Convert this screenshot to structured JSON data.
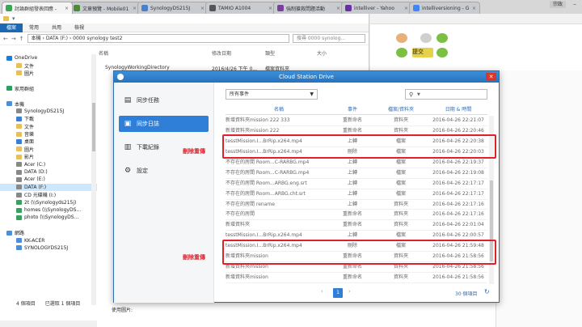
{
  "browser": {
    "tabs": [
      {
        "label": "討論群組發表回應 -",
        "color": "#3aa655",
        "active": true
      },
      {
        "label": "文章預覽 - Mobile01",
        "color": "#4a8a3a",
        "active": false
      },
      {
        "label": "SynologyDS215J",
        "color": "#4a7fcc",
        "active": false
      },
      {
        "label": "TAMIO A1004",
        "color": "#555555",
        "active": false
      },
      {
        "label": "強制搶救問題活動",
        "color": "#7b3fa0",
        "active": false
      },
      {
        "label": "intelliver - Yahoo",
        "color": "#6a2fa0",
        "active": false
      },
      {
        "label": "intelliversioning - G",
        "color": "#4285f4",
        "active": false
      }
    ],
    "user_badge": "宗政"
  },
  "explorer": {
    "ribbon_tabs": [
      "檔案",
      "常用",
      "共用",
      "檢視"
    ],
    "address_parts": [
      "本機",
      "DATA (F:)",
      "0000 synology test2"
    ],
    "search_placeholder": "搜尋 0000 synolog...",
    "columns": [
      "名稱",
      "修改日期",
      "類型",
      "大小"
    ],
    "file": {
      "name": "SynologyWorkingDirectory",
      "date": "2016/4/26 下午 0...",
      "type": "檔案資料夾"
    },
    "nav": [
      {
        "label": "OneDrive",
        "color": "#1e7bd7",
        "indent": 0
      },
      {
        "label": "文件",
        "color": "#e8c05a",
        "indent": 1
      },
      {
        "label": "圖片",
        "color": "#e8c05a",
        "indent": 1
      },
      {
        "label": "",
        "color": "",
        "indent": 0
      },
      {
        "label": "家用群組",
        "color": "#2aa060",
        "indent": 0
      },
      {
        "label": "",
        "color": "",
        "indent": 0
      },
      {
        "label": "本機",
        "color": "#4a8fd8",
        "indent": 0
      },
      {
        "label": "SynologyDS215J",
        "color": "#888888",
        "indent": 1
      },
      {
        "label": "下載",
        "color": "#3a7fd0",
        "indent": 1
      },
      {
        "label": "文件",
        "color": "#e8c05a",
        "indent": 1
      },
      {
        "label": "音樂",
        "color": "#e8c05a",
        "indent": 1
      },
      {
        "label": "桌面",
        "color": "#3a7fd0",
        "indent": 1
      },
      {
        "label": "圖片",
        "color": "#e8c05a",
        "indent": 1
      },
      {
        "label": "影片",
        "color": "#e8c05a",
        "indent": 1
      },
      {
        "label": "Acer (C:)",
        "color": "#888888",
        "indent": 1
      },
      {
        "label": "DATA (D:)",
        "color": "#888888",
        "indent": 1
      },
      {
        "label": "Acer (E:)",
        "color": "#888888",
        "indent": 1
      },
      {
        "label": "DATA (F:)",
        "color": "#888888",
        "indent": 1,
        "selected": true
      },
      {
        "label": "CD 光碟機 (I:)",
        "color": "#888888",
        "indent": 1
      },
      {
        "label": "2t (\\\\Synologyds215j)",
        "color": "#3aa060",
        "indent": 1
      },
      {
        "label": "homes (\\\\SynologyDS...",
        "color": "#3aa060",
        "indent": 1
      },
      {
        "label": "photo (\\\\SynologyDS...",
        "color": "#3aa060",
        "indent": 1
      },
      {
        "label": "",
        "color": "",
        "indent": 0
      },
      {
        "label": "網路",
        "color": "#4a8fd8",
        "indent": 0
      },
      {
        "label": "KK-ACER",
        "color": "#4a8fd8",
        "indent": 1
      },
      {
        "label": "SYNOLOGYDS215J",
        "color": "#4a8fd8",
        "indent": 1
      }
    ],
    "status_items": "4 個項目",
    "status_selected": "已選取 1 個項目"
  },
  "webpage": {
    "bottom_label": "使用圖片:",
    "button_label": "提交"
  },
  "csd": {
    "title": "Cloud Station Drive",
    "nav": [
      {
        "label": "同步任務",
        "icon": "▤",
        "active": false
      },
      {
        "label": "同步日誌",
        "icon": "▣",
        "active": true
      },
      {
        "label": "下載紀錄",
        "icon": "▥",
        "active": false
      },
      {
        "label": "設定",
        "icon": "⚙",
        "active": false
      }
    ],
    "filter": "所有事件",
    "search_icon": "⚲",
    "columns": {
      "name": "名稱",
      "event": "事件",
      "type": "檔案/資料夾",
      "date": "日期 & 時間"
    },
    "rows": [
      {
        "name": "新增資料夾mission 222 333",
        "event": "重新命名",
        "type": "資料夾",
        "date": "2016-04-26 22:21:07"
      },
      {
        "name": "新增資料夾mission 222",
        "event": "重新命名",
        "type": "資料夾",
        "date": "2016-04-26 22:20:46"
      },
      {
        "name": "tesstMission.I...BrRip.x264.mp4",
        "event": "上轉",
        "type": "檔案",
        "date": "2016-04-26 22:20:38"
      },
      {
        "name": "tesstMission.I...BrRip.x264.mp4",
        "event": "刪除",
        "type": "檔案",
        "date": "2016-04-26 22:20:03"
      },
      {
        "name": "不存在的房間 Room...C-RARBG.mp4",
        "event": "上轉",
        "type": "檔案",
        "date": "2016-04-26 22:19:37"
      },
      {
        "name": "不存在的房間 Room...C-RARBG.mp4",
        "event": "上轉",
        "type": "檔案",
        "date": "2016-04-26 22:19:08"
      },
      {
        "name": "不存在的房間 Room...ARBG.eng.srt",
        "event": "上轉",
        "type": "檔案",
        "date": "2016-04-26 22:17:17"
      },
      {
        "name": "不存在的房間 Room...ARBG.cht.srt",
        "event": "上轉",
        "type": "檔案",
        "date": "2016-04-26 22:17:17"
      },
      {
        "name": "不存在的房間 rename",
        "event": "上轉",
        "type": "資料夾",
        "date": "2016-04-26 22:17:16"
      },
      {
        "name": "不存在的房間",
        "event": "重新命名",
        "type": "資料夾",
        "date": "2016-04-26 22:17:16"
      },
      {
        "name": "新增資料夾",
        "event": "重新命名",
        "type": "資料夾",
        "date": "2016-04-26 22:01:04"
      },
      {
        "name": "tesstMission.I...BrRip.x264.mp4",
        "event": "上轉",
        "type": "檔案",
        "date": "2016-04-26 22:00:57"
      },
      {
        "name": "tesstMission.I...BrRip.x264.mp4",
        "event": "刪除",
        "type": "檔案",
        "date": "2016-04-26 21:59:48"
      },
      {
        "name": "新增資料夾mission",
        "event": "重新命名",
        "type": "資料夾",
        "date": "2016-04-26 21:58:56"
      },
      {
        "name": "新增資料夾mission",
        "event": "重新命名",
        "type": "資料夾",
        "date": "2016-04-26 21:58:56"
      },
      {
        "name": "新增資料夾mission",
        "event": "重新命名",
        "type": "資料夾",
        "date": "2016-04-26 21:58:56"
      }
    ],
    "page": "1",
    "total": "30 個項目"
  },
  "annotations": {
    "first": "刪除重傳",
    "second": "刪除重傳",
    "color": "#e0202a"
  }
}
